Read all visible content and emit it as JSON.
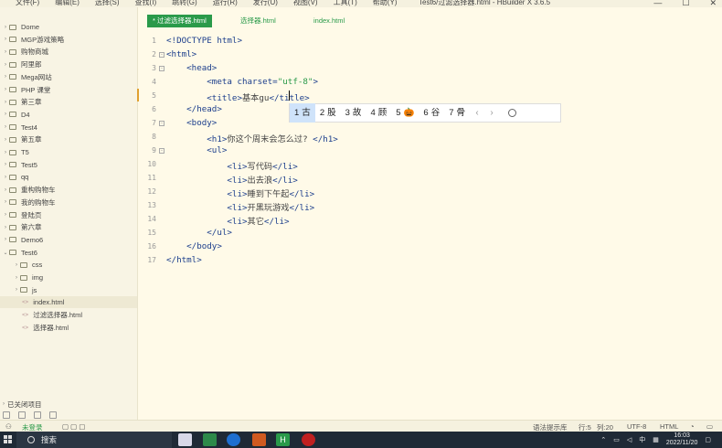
{
  "window": {
    "title": "Test6/过滤选择器.html - HBuilder X 3.6.5",
    "menu": [
      "文件(F)",
      "编辑(E)",
      "选择(S)",
      "查找(I)",
      "跳转(G)",
      "运行(R)",
      "发行(U)",
      "视图(V)",
      "工具(T)",
      "帮助(Y)"
    ]
  },
  "sidebar": {
    "items": [
      {
        "label": "Dome",
        "type": "folder"
      },
      {
        "label": "MGP游戏策略",
        "type": "folder"
      },
      {
        "label": "购物商城",
        "type": "folder"
      },
      {
        "label": "阿里郎",
        "type": "folder"
      },
      {
        "label": "Mega网站",
        "type": "folder"
      },
      {
        "label": "PHP 课堂",
        "type": "folder"
      },
      {
        "label": "第三章",
        "type": "folder"
      },
      {
        "label": "D4",
        "type": "folder"
      },
      {
        "label": "Test4",
        "type": "folder"
      },
      {
        "label": "第五章",
        "type": "folder"
      },
      {
        "label": "T5",
        "type": "folder"
      },
      {
        "label": "Test5",
        "type": "folder"
      },
      {
        "label": "qq",
        "type": "folder"
      },
      {
        "label": "重构购物车",
        "type": "folder"
      },
      {
        "label": "我的购物车",
        "type": "folder"
      },
      {
        "label": "登陆页",
        "type": "folder"
      },
      {
        "label": "第六章",
        "type": "folder"
      },
      {
        "label": "Demo6",
        "type": "folder"
      },
      {
        "label": "Test6",
        "type": "folder-open"
      },
      {
        "label": "css",
        "type": "subfolder"
      },
      {
        "label": "img",
        "type": "subfolder"
      },
      {
        "label": "js",
        "type": "subfolder"
      },
      {
        "label": "index.html",
        "type": "file",
        "selected": true
      },
      {
        "label": "过滤选择器.html",
        "type": "file"
      },
      {
        "label": "选择器.html",
        "type": "file"
      }
    ],
    "closed_projects": "已关闭项目"
  },
  "tabs": [
    {
      "label": "* 过滤选择器.html",
      "active": true
    },
    {
      "label": "选择器.html",
      "active": false
    },
    {
      "label": "index.html",
      "active": false
    }
  ],
  "editor": {
    "line_numbers": [
      "1",
      "2",
      "3",
      "4",
      "5",
      "6",
      "7",
      "8",
      "9",
      "10",
      "11",
      "12",
      "13",
      "14",
      "15",
      "16",
      "17"
    ],
    "lines": [
      {
        "indent": "",
        "parts": [
          {
            "t": "<!DOCTYPE html>",
            "c": "tag"
          }
        ]
      },
      {
        "indent": "",
        "parts": [
          {
            "t": "<html>",
            "c": "tag"
          }
        ]
      },
      {
        "indent": "    ",
        "parts": [
          {
            "t": "<head>",
            "c": "tag"
          }
        ]
      },
      {
        "indent": "        ",
        "parts": [
          {
            "t": "<meta charset=",
            "c": "tag"
          },
          {
            "t": "\"utf-8\"",
            "c": "str"
          },
          {
            "t": ">",
            "c": "tag"
          }
        ]
      },
      {
        "indent": "        ",
        "parts": [
          {
            "t": "<title>",
            "c": "tag"
          },
          {
            "t": "基本gu",
            "c": "cn"
          },
          {
            "t": "</title>",
            "c": "tag"
          }
        ]
      },
      {
        "indent": "    ",
        "parts": [
          {
            "t": "</head>",
            "c": "tag"
          }
        ]
      },
      {
        "indent": "    ",
        "parts": [
          {
            "t": "<body>",
            "c": "tag"
          }
        ]
      },
      {
        "indent": "        ",
        "parts": [
          {
            "t": "<h1>",
            "c": "tag"
          },
          {
            "t": "你这个周末会怎么过? ",
            "c": "cn"
          },
          {
            "t": "</h1>",
            "c": "tag"
          }
        ]
      },
      {
        "indent": "        ",
        "parts": [
          {
            "t": "<ul>",
            "c": "tag"
          }
        ]
      },
      {
        "indent": "            ",
        "parts": [
          {
            "t": "<li>",
            "c": "tag"
          },
          {
            "t": "写代码",
            "c": "cn"
          },
          {
            "t": "</li>",
            "c": "tag"
          }
        ]
      },
      {
        "indent": "            ",
        "parts": [
          {
            "t": "<li>",
            "c": "tag"
          },
          {
            "t": "出去浪",
            "c": "cn"
          },
          {
            "t": "</li>",
            "c": "tag"
          }
        ]
      },
      {
        "indent": "            ",
        "parts": [
          {
            "t": "<li>",
            "c": "tag"
          },
          {
            "t": "睡到下午起",
            "c": "cn"
          },
          {
            "t": "</li>",
            "c": "tag"
          }
        ]
      },
      {
        "indent": "            ",
        "parts": [
          {
            "t": "<li>",
            "c": "tag"
          },
          {
            "t": "开黑玩游戏",
            "c": "cn"
          },
          {
            "t": "</li>",
            "c": "tag"
          }
        ]
      },
      {
        "indent": "            ",
        "parts": [
          {
            "t": "<li>",
            "c": "tag"
          },
          {
            "t": "其它",
            "c": "cn"
          },
          {
            "t": "</li>",
            "c": "tag"
          }
        ]
      },
      {
        "indent": "        ",
        "parts": [
          {
            "t": "</ul>",
            "c": "tag"
          }
        ]
      },
      {
        "indent": "    ",
        "parts": [
          {
            "t": "</body>",
            "c": "tag"
          }
        ]
      },
      {
        "indent": "",
        "parts": [
          {
            "t": "</html>",
            "c": "tag"
          }
        ]
      }
    ]
  },
  "ime": {
    "candidates": [
      {
        "num": "1",
        "text": "古"
      },
      {
        "num": "2",
        "text": "股"
      },
      {
        "num": "3",
        "text": "故"
      },
      {
        "num": "4",
        "text": "顾"
      },
      {
        "num": "5",
        "text": "🎃"
      },
      {
        "num": "6",
        "text": "谷"
      },
      {
        "num": "7",
        "text": "骨"
      }
    ],
    "prev": "‹",
    "next": "›"
  },
  "statusbar": {
    "login": "未登录",
    "syntax": "语法提示库",
    "row": "行:5",
    "col": "列:20",
    "encoding": "UTF-8",
    "language": "HTML"
  },
  "taskbar": {
    "search_placeholder": "搜索",
    "ime_mode": "中",
    "time": "16:03",
    "date": "2022/11/20"
  }
}
